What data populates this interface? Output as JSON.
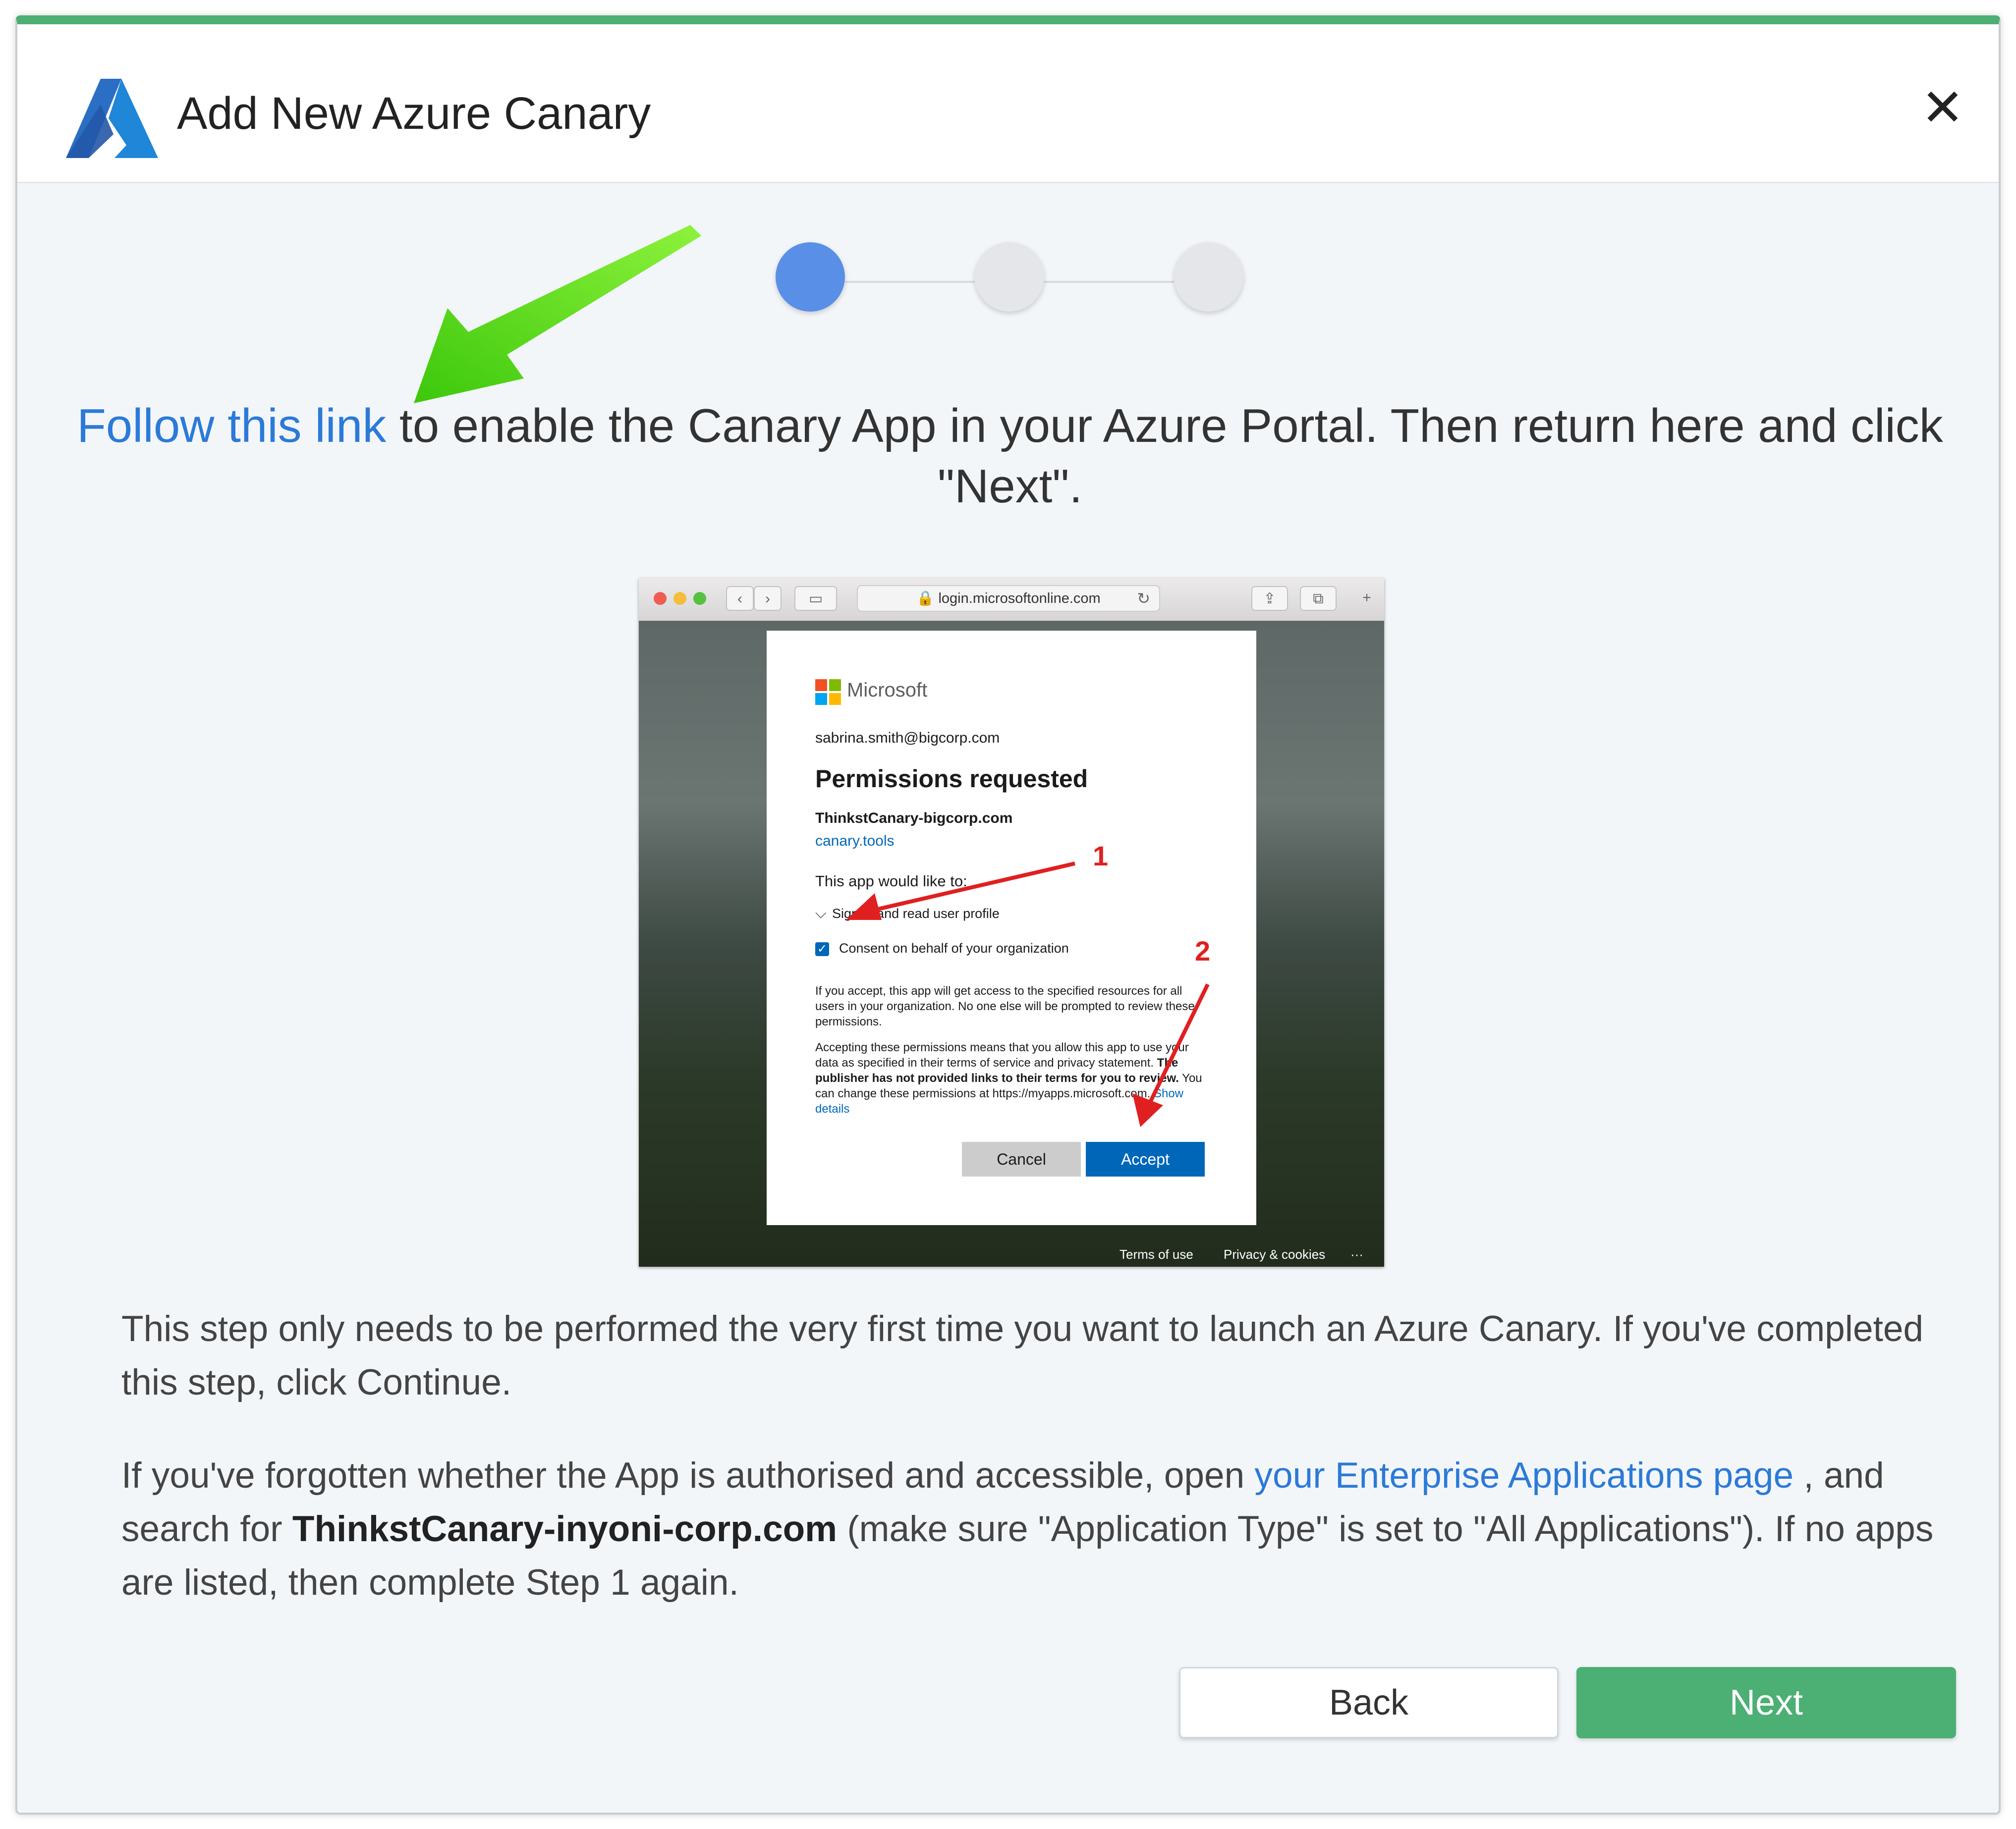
{
  "header": {
    "title": "Add New Azure Canary"
  },
  "steps": {
    "count": 3,
    "current": 1
  },
  "instruction": {
    "link": "Follow this link",
    "rest": " to enable the Canary App in your Azure Portal. Then return here and click \"Next\"."
  },
  "screenshot": {
    "url": "login.microsoftonline.com",
    "brand": "Microsoft",
    "email": "sabrina.smith@bigcorp.com",
    "title": "Permissions requested",
    "app_name": "ThinkstCanary-bigcorp.com",
    "app_domain": "canary.tools",
    "would_like": "This app would like to:",
    "perm1": "Sign in and read user profile",
    "perm2": "Consent on behalf of your organization",
    "fine1": "If you accept, this app will get access to the specified resources for all users in your organization. No one else will be prompted to review these permissions.",
    "fine2_a": "Accepting these permissions means that you allow this app to use your data as specified in their terms of service and privacy statement. ",
    "fine2_bold": "The publisher has not provided links to their terms for you to review.",
    "fine2_b": " You can change these permissions at https://myapps.microsoft.com. ",
    "fine2_link": "Show details",
    "cancel": "Cancel",
    "accept": "Accept",
    "annotation1": "1",
    "annotation2": "2",
    "footer_terms": "Terms of use",
    "footer_privacy": "Privacy & cookies",
    "footer_more": "···"
  },
  "para1": "This step only needs to be performed the very first time you want to launch an Azure Canary. If you've completed this step, click Continue.",
  "para2": {
    "a": "If you've forgotten whether the App is authorised and accessible, open ",
    "link": "your Enterprise Applications page",
    "b": " , and search for ",
    "bold": "ThinkstCanary-inyoni-corp.com",
    "c": " (make sure \"Application Type\" is set to \"All Applications\"). If no apps are listed, then complete Step 1 again."
  },
  "buttons": {
    "back": "Back",
    "next": "Next"
  },
  "colors": {
    "accent_green": "#4caf74",
    "link_blue": "#2b7ad8",
    "step_active": "#5a8fe8",
    "ms_blue": "#0067b8"
  }
}
